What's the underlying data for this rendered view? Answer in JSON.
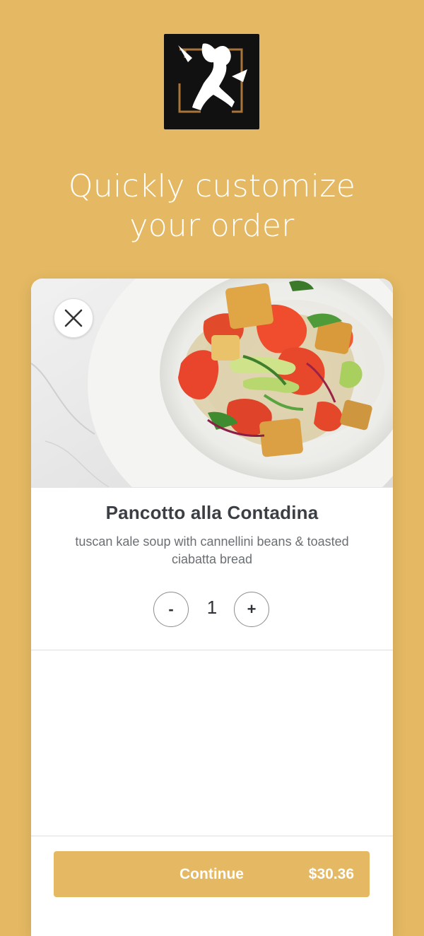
{
  "headline": [
    "Quickly customize",
    "your order"
  ],
  "item": {
    "name": "Pancotto alla Contadina",
    "description": "tuscan kale soup with cannellini beans & toasted ciabatta bread",
    "quantity": "1",
    "minus_label": "-",
    "plus_label": "+"
  },
  "footer": {
    "continue_label": "Continue",
    "price": "$30.36"
  },
  "colors": {
    "background": "#E5B963",
    "accent": "#E5B963",
    "title_text": "#3B3F44",
    "desc_text": "#6B6F73"
  },
  "icons": {
    "logo": "chef-silhouette-logo",
    "close": "close-icon"
  }
}
